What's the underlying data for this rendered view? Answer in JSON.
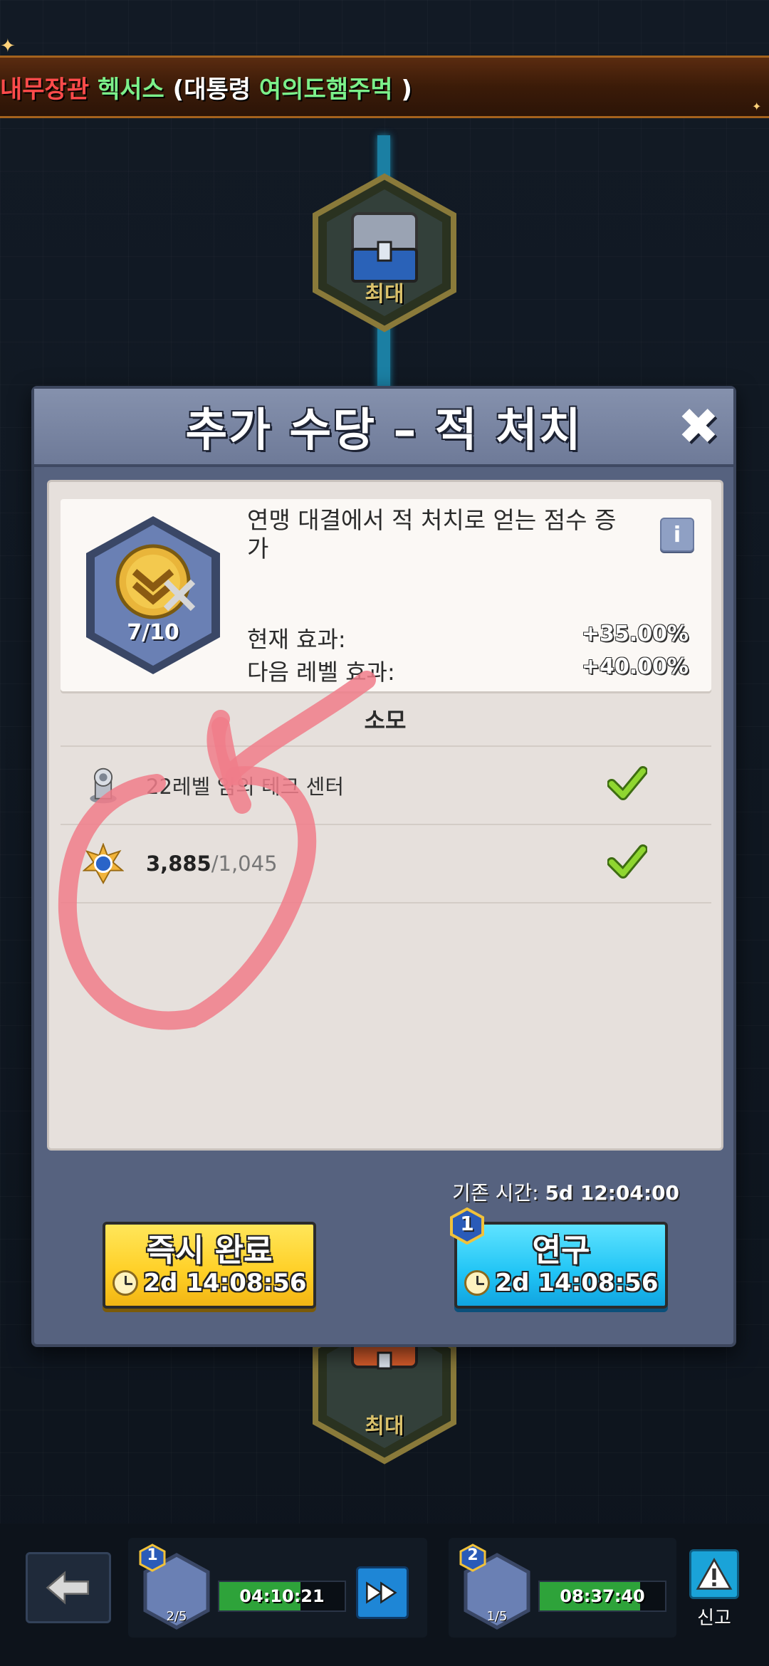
{
  "banner": {
    "part1": "내무장관",
    "part2": "헥서스",
    "part3": "(대통령",
    "part4": "여의도햄주먹",
    "part5": ")"
  },
  "nodes": {
    "top_label": "최대",
    "bottom_label": "최대"
  },
  "modal": {
    "title": "추가 수당 – 적 처치",
    "close_icon": "close-icon",
    "description": "연맹 대결에서 적 처치로 얻는 점수 증가",
    "level": "7/10",
    "current_effect_label": "현재 효과:",
    "current_effect_value": "+35.00%",
    "next_effect_label": "다음 레벨 효과:",
    "next_effect_value": "+40.00%",
    "cost_title": "소모",
    "requirements": [
      {
        "icon": "tech-center-icon",
        "text": "22레벨 임의 테크 센터",
        "met": true
      },
      {
        "icon": "medal-icon",
        "have": "3,885",
        "need": "/1,045",
        "met": true
      }
    ],
    "base_time_label": "기존 시간:",
    "base_time_value": "5d 12:04:00",
    "instant_button": {
      "label": "즉시 완료",
      "time": "2d 14:08:56"
    },
    "research_button": {
      "label": "연구",
      "time": "2d 14:08:56",
      "queue_number": "1"
    }
  },
  "bottom_bar": {
    "queues": [
      {
        "number": "1",
        "count": "2/5",
        "time": "04:10:21"
      },
      {
        "number": "2",
        "count": "1/5",
        "time": "08:37:40"
      }
    ],
    "report_label": "신고"
  },
  "colors": {
    "modal_bg": "#56627f",
    "yellow_button": "#ffcf25",
    "blue_button": "#20c4f5",
    "check_green": "#7ed321",
    "annotation": "#f07d8a"
  }
}
